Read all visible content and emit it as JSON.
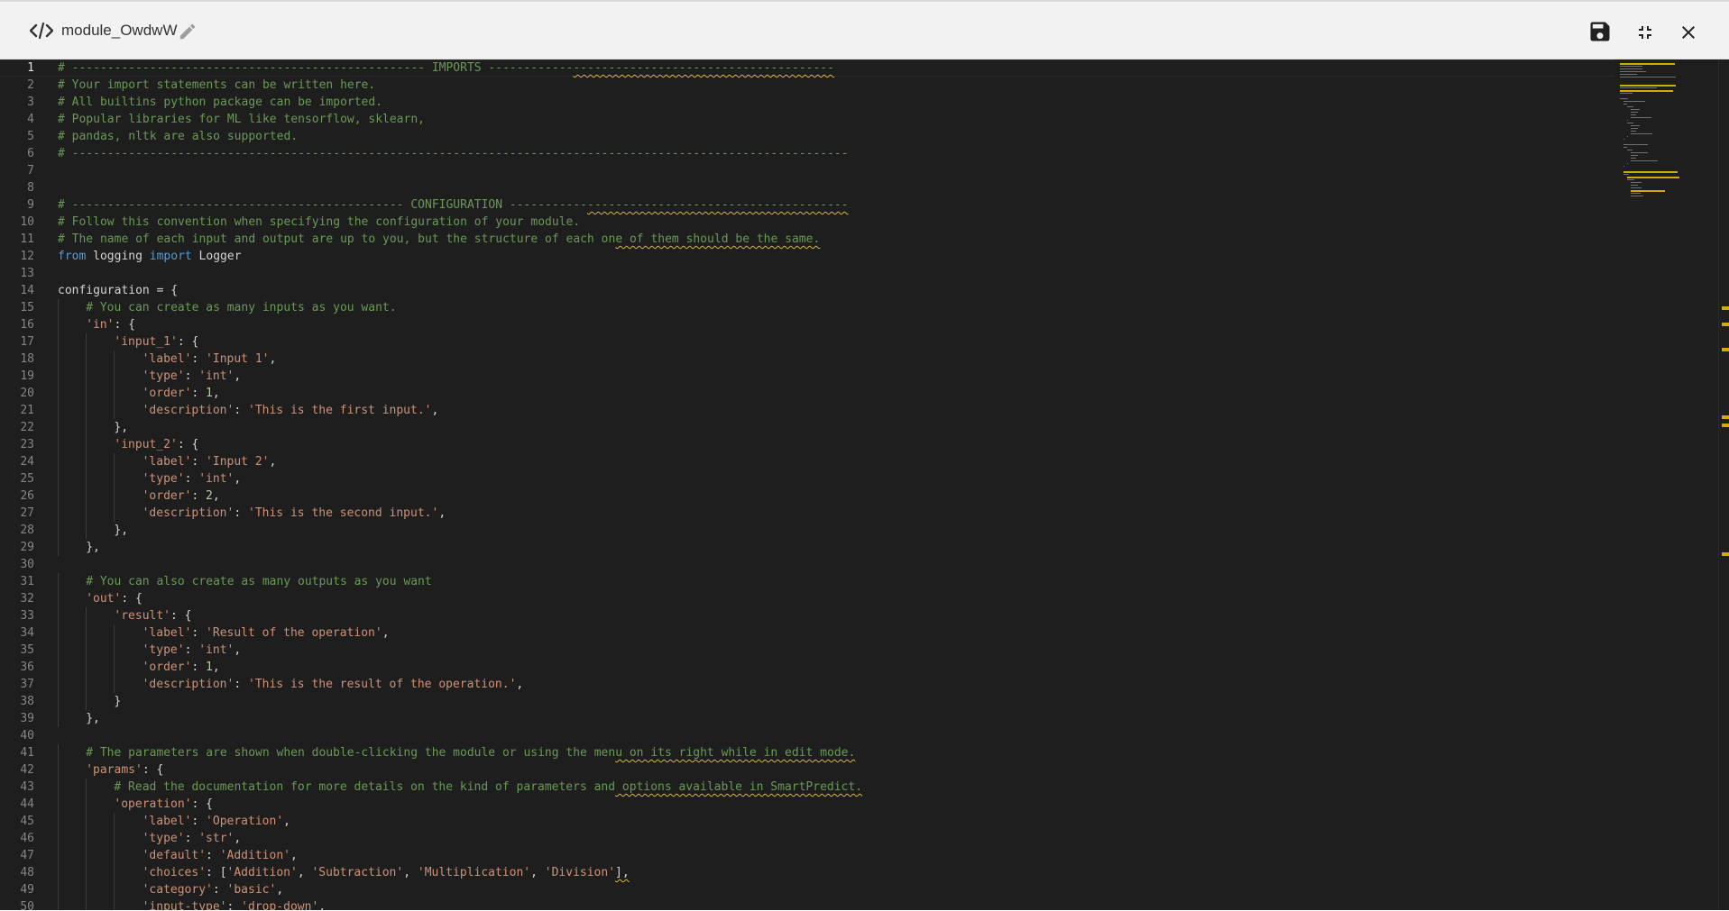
{
  "header": {
    "module_name": "module_OwdwW",
    "icons": {
      "code": "code-icon",
      "edit": "pencil-icon",
      "save": "floppy-disk-icon",
      "collapse": "collapse-icon",
      "close": "close-icon"
    }
  },
  "colors": {
    "comment": "#6a9955",
    "keyword": "#569cd6",
    "string": "#ce9178",
    "number": "#b5cea8",
    "text": "#d4d4d4",
    "warning_squiggle": "#d7ba30",
    "editor_background": "#1e1e1e"
  },
  "editor": {
    "current_line": 1,
    "lines": [
      {
        "n": "1",
        "indent": 0,
        "segs": [
          {
            "t": "# -------------------------------------------------- IMPORTS ------------",
            "c": "cm"
          },
          {
            "t": "-------------------------------------",
            "c": "cm sq"
          }
        ]
      },
      {
        "n": "2",
        "indent": 0,
        "segs": [
          {
            "t": "# Your import statements can be written here.",
            "c": "cm"
          }
        ]
      },
      {
        "n": "3",
        "indent": 0,
        "segs": [
          {
            "t": "# All builtins python package can be imported.",
            "c": "cm"
          }
        ]
      },
      {
        "n": "4",
        "indent": 0,
        "segs": [
          {
            "t": "# Popular libraries for ML like tensorflow, sklearn,",
            "c": "cm"
          }
        ]
      },
      {
        "n": "5",
        "indent": 0,
        "segs": [
          {
            "t": "# pandas, nltk are also supported.",
            "c": "cm"
          }
        ]
      },
      {
        "n": "6",
        "indent": 0,
        "segs": [
          {
            "t": "# --------------------------------------------------------------------------------------------------------------",
            "c": "cm"
          }
        ]
      },
      {
        "n": "7",
        "indent": 0,
        "segs": []
      },
      {
        "n": "8",
        "indent": 0,
        "segs": []
      },
      {
        "n": "9",
        "indent": 0,
        "segs": [
          {
            "t": "# ----------------------------------------------- CONFIGURATION -----------",
            "c": "cm"
          },
          {
            "t": "-------------------------------------",
            "c": "cm sq"
          }
        ]
      },
      {
        "n": "10",
        "indent": 0,
        "segs": [
          {
            "t": "# Follow this convention when specifying the configuration of your module.",
            "c": "cm"
          }
        ]
      },
      {
        "n": "11",
        "indent": 0,
        "segs": [
          {
            "t": "# The name of each input and output are up to you, but the structure of each on",
            "c": "cm"
          },
          {
            "t": "e of them should be the same.",
            "c": "cm sq"
          }
        ]
      },
      {
        "n": "12",
        "indent": 0,
        "segs": [
          {
            "t": "from",
            "c": "kw"
          },
          {
            "t": " logging ",
            "c": ""
          },
          {
            "t": "import",
            "c": "kw"
          },
          {
            "t": " Logger",
            "c": ""
          }
        ]
      },
      {
        "n": "13",
        "indent": 0,
        "segs": []
      },
      {
        "n": "14",
        "indent": 0,
        "segs": [
          {
            "t": "configuration = {",
            "c": ""
          }
        ]
      },
      {
        "n": "15",
        "indent": 1,
        "segs": [
          {
            "t": "# You can create as many inputs as you want.",
            "c": "cm"
          }
        ]
      },
      {
        "n": "16",
        "indent": 1,
        "segs": [
          {
            "t": "'in'",
            "c": "str"
          },
          {
            "t": ": {",
            "c": ""
          }
        ]
      },
      {
        "n": "17",
        "indent": 2,
        "segs": [
          {
            "t": "'input_1'",
            "c": "str"
          },
          {
            "t": ": {",
            "c": ""
          }
        ]
      },
      {
        "n": "18",
        "indent": 3,
        "segs": [
          {
            "t": "'label'",
            "c": "str"
          },
          {
            "t": ": ",
            "c": ""
          },
          {
            "t": "'Input 1'",
            "c": "str"
          },
          {
            "t": ",",
            "c": ""
          }
        ]
      },
      {
        "n": "19",
        "indent": 3,
        "segs": [
          {
            "t": "'type'",
            "c": "str"
          },
          {
            "t": ": ",
            "c": ""
          },
          {
            "t": "'int'",
            "c": "str"
          },
          {
            "t": ",",
            "c": ""
          }
        ]
      },
      {
        "n": "20",
        "indent": 3,
        "segs": [
          {
            "t": "'order'",
            "c": "str"
          },
          {
            "t": ": ",
            "c": ""
          },
          {
            "t": "1",
            "c": "num"
          },
          {
            "t": ",",
            "c": ""
          }
        ]
      },
      {
        "n": "21",
        "indent": 3,
        "segs": [
          {
            "t": "'description'",
            "c": "str"
          },
          {
            "t": ": ",
            "c": ""
          },
          {
            "t": "'This is the first input.'",
            "c": "str"
          },
          {
            "t": ",",
            "c": ""
          }
        ]
      },
      {
        "n": "22",
        "indent": 2,
        "segs": [
          {
            "t": "},",
            "c": ""
          }
        ]
      },
      {
        "n": "23",
        "indent": 2,
        "segs": [
          {
            "t": "'input_2'",
            "c": "str"
          },
          {
            "t": ": {",
            "c": ""
          }
        ]
      },
      {
        "n": "24",
        "indent": 3,
        "segs": [
          {
            "t": "'label'",
            "c": "str"
          },
          {
            "t": ": ",
            "c": ""
          },
          {
            "t": "'Input 2'",
            "c": "str"
          },
          {
            "t": ",",
            "c": ""
          }
        ]
      },
      {
        "n": "25",
        "indent": 3,
        "segs": [
          {
            "t": "'type'",
            "c": "str"
          },
          {
            "t": ": ",
            "c": ""
          },
          {
            "t": "'int'",
            "c": "str"
          },
          {
            "t": ",",
            "c": ""
          }
        ]
      },
      {
        "n": "26",
        "indent": 3,
        "segs": [
          {
            "t": "'order'",
            "c": "str"
          },
          {
            "t": ": ",
            "c": ""
          },
          {
            "t": "2",
            "c": "num"
          },
          {
            "t": ",",
            "c": ""
          }
        ]
      },
      {
        "n": "27",
        "indent": 3,
        "segs": [
          {
            "t": "'description'",
            "c": "str"
          },
          {
            "t": ": ",
            "c": ""
          },
          {
            "t": "'This is the second input.'",
            "c": "str"
          },
          {
            "t": ",",
            "c": ""
          }
        ]
      },
      {
        "n": "28",
        "indent": 2,
        "segs": [
          {
            "t": "},",
            "c": ""
          }
        ]
      },
      {
        "n": "29",
        "indent": 1,
        "segs": [
          {
            "t": "},",
            "c": ""
          }
        ]
      },
      {
        "n": "30",
        "indent": 0,
        "segs": []
      },
      {
        "n": "31",
        "indent": 1,
        "segs": [
          {
            "t": "# You can also create as many outputs as you want",
            "c": "cm"
          }
        ]
      },
      {
        "n": "32",
        "indent": 1,
        "segs": [
          {
            "t": "'out'",
            "c": "str"
          },
          {
            "t": ": {",
            "c": ""
          }
        ]
      },
      {
        "n": "33",
        "indent": 2,
        "segs": [
          {
            "t": "'result'",
            "c": "str"
          },
          {
            "t": ": {",
            "c": ""
          }
        ]
      },
      {
        "n": "34",
        "indent": 3,
        "segs": [
          {
            "t": "'label'",
            "c": "str"
          },
          {
            "t": ": ",
            "c": ""
          },
          {
            "t": "'Result of the operation'",
            "c": "str"
          },
          {
            "t": ",",
            "c": ""
          }
        ]
      },
      {
        "n": "35",
        "indent": 3,
        "segs": [
          {
            "t": "'type'",
            "c": "str"
          },
          {
            "t": ": ",
            "c": ""
          },
          {
            "t": "'int'",
            "c": "str"
          },
          {
            "t": ",",
            "c": ""
          }
        ]
      },
      {
        "n": "36",
        "indent": 3,
        "segs": [
          {
            "t": "'order'",
            "c": "str"
          },
          {
            "t": ": ",
            "c": ""
          },
          {
            "t": "1",
            "c": "num"
          },
          {
            "t": ",",
            "c": ""
          }
        ]
      },
      {
        "n": "37",
        "indent": 3,
        "segs": [
          {
            "t": "'description'",
            "c": "str"
          },
          {
            "t": ": ",
            "c": ""
          },
          {
            "t": "'This is the result of the operation.'",
            "c": "str"
          },
          {
            "t": ",",
            "c": ""
          }
        ]
      },
      {
        "n": "38",
        "indent": 2,
        "segs": [
          {
            "t": "}",
            "c": ""
          }
        ]
      },
      {
        "n": "39",
        "indent": 1,
        "segs": [
          {
            "t": "},",
            "c": ""
          }
        ]
      },
      {
        "n": "40",
        "indent": 0,
        "segs": []
      },
      {
        "n": "41",
        "indent": 1,
        "segs": [
          {
            "t": "# The parameters are shown when double-clicking the module or using the men",
            "c": "cm"
          },
          {
            "t": "u on its right while in edit mode.",
            "c": "cm sq"
          }
        ]
      },
      {
        "n": "42",
        "indent": 1,
        "segs": [
          {
            "t": "'params'",
            "c": "str"
          },
          {
            "t": ": {",
            "c": ""
          }
        ]
      },
      {
        "n": "43",
        "indent": 2,
        "segs": [
          {
            "t": "# Read the documentation for more details on the kind of parameters and",
            "c": "cm"
          },
          {
            "t": " options available in SmartPredict.",
            "c": "cm sq"
          }
        ]
      },
      {
        "n": "44",
        "indent": 2,
        "segs": [
          {
            "t": "'operation'",
            "c": "str"
          },
          {
            "t": ": {",
            "c": ""
          }
        ]
      },
      {
        "n": "45",
        "indent": 3,
        "segs": [
          {
            "t": "'label'",
            "c": "str"
          },
          {
            "t": ": ",
            "c": ""
          },
          {
            "t": "'Operation'",
            "c": "str"
          },
          {
            "t": ",",
            "c": ""
          }
        ]
      },
      {
        "n": "46",
        "indent": 3,
        "segs": [
          {
            "t": "'type'",
            "c": "str"
          },
          {
            "t": ": ",
            "c": ""
          },
          {
            "t": "'str'",
            "c": "str"
          },
          {
            "t": ",",
            "c": ""
          }
        ]
      },
      {
        "n": "47",
        "indent": 3,
        "segs": [
          {
            "t": "'default'",
            "c": "str"
          },
          {
            "t": ": ",
            "c": ""
          },
          {
            "t": "'Addition'",
            "c": "str"
          },
          {
            "t": ",",
            "c": ""
          }
        ]
      },
      {
        "n": "48",
        "indent": 3,
        "segs": [
          {
            "t": "'choices'",
            "c": "str"
          },
          {
            "t": ": [",
            "c": ""
          },
          {
            "t": "'Addition'",
            "c": "str"
          },
          {
            "t": ", ",
            "c": ""
          },
          {
            "t": "'Subtraction'",
            "c": "str"
          },
          {
            "t": ", ",
            "c": ""
          },
          {
            "t": "'Multiplication'",
            "c": "str"
          },
          {
            "t": ", ",
            "c": ""
          },
          {
            "t": "'Division'",
            "c": "str"
          },
          {
            "t": "],",
            "c": "sq"
          }
        ]
      },
      {
        "n": "49",
        "indent": 3,
        "segs": [
          {
            "t": "'category'",
            "c": "str"
          },
          {
            "t": ": ",
            "c": ""
          },
          {
            "t": "'basic'",
            "c": "str"
          },
          {
            "t": ",",
            "c": ""
          }
        ]
      },
      {
        "n": "50",
        "indent": 3,
        "segs": [
          {
            "t": "'input-type'",
            "c": "str"
          },
          {
            "t": ": ",
            "c": ""
          },
          {
            "t": "'drop-down'",
            "c": "str"
          },
          {
            "t": ",",
            "c": ""
          }
        ]
      }
    ]
  }
}
